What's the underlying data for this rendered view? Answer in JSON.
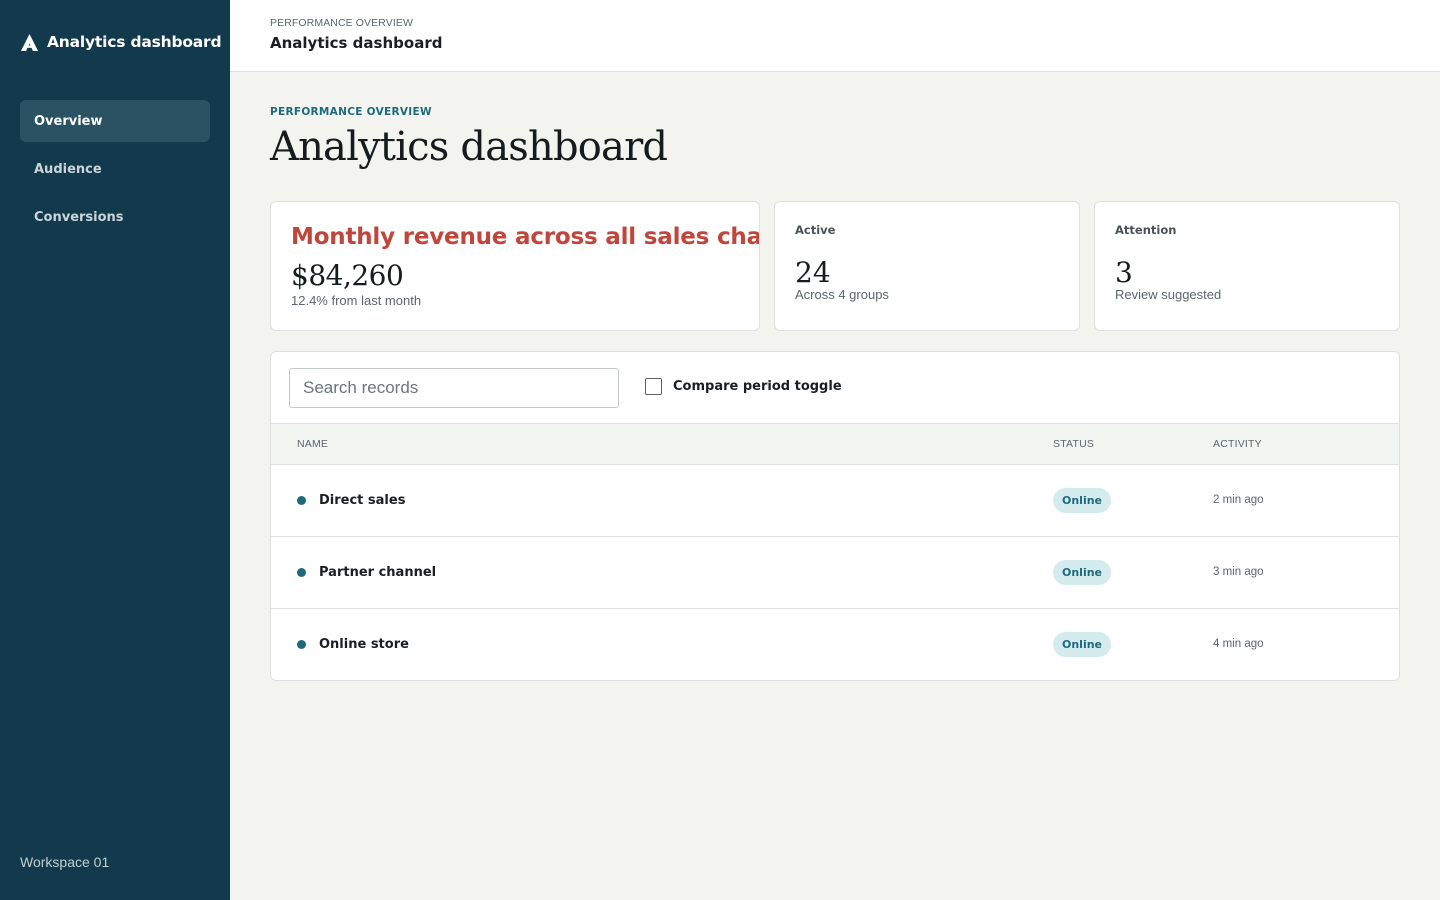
{
  "sidebar": {
    "brand_name": "Analytics dashboard",
    "logo_icon": "logo-a-icon",
    "items": [
      {
        "label": "Overview",
        "active": true
      },
      {
        "label": "Audience",
        "active": false
      },
      {
        "label": "Conversions",
        "active": false
      }
    ],
    "workspace": "Workspace 01",
    "background_color": "#123a4c"
  },
  "topbar": {
    "eyebrow": "PERFORMANCE OVERVIEW",
    "title": "Analytics dashboard"
  },
  "header": {
    "eyebrow": "PERFORMANCE OVERVIEW",
    "title": "Analytics dashboard"
  },
  "cards": {
    "revenue": {
      "label": "Monthly revenue across all sales channels",
      "value": "$84,260",
      "sub": "12.4% from last month",
      "label_color": "#c0453b"
    },
    "active": {
      "label": "Active",
      "value": "24",
      "sub": "Across 4 groups"
    },
    "attention": {
      "label": "Attention",
      "value": "3",
      "sub": "Review suggested"
    }
  },
  "records": {
    "search_placeholder": "Search records",
    "search_value": "",
    "toggle_label": "Compare period toggle",
    "toggle_checked": false,
    "columns": {
      "name": "NAME",
      "status": "STATUS",
      "activity": "ACTIVITY"
    },
    "rows": [
      {
        "name": "Direct sales",
        "status": "Online",
        "activity": "2 min ago"
      },
      {
        "name": "Partner channel",
        "status": "Online",
        "activity": "3 min ago"
      },
      {
        "name": "Online store",
        "status": "Online",
        "activity": "4 min ago"
      }
    ],
    "status_color": "#1e6a7d"
  }
}
